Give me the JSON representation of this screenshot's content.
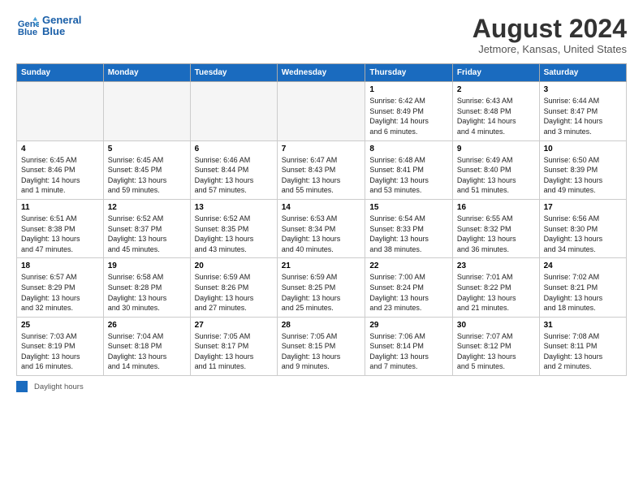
{
  "logo": {
    "line1": "General",
    "line2": "Blue"
  },
  "title": "August 2024",
  "location": "Jetmore, Kansas, United States",
  "days_of_week": [
    "Sunday",
    "Monday",
    "Tuesday",
    "Wednesday",
    "Thursday",
    "Friday",
    "Saturday"
  ],
  "weeks": [
    [
      {
        "day": "",
        "info": ""
      },
      {
        "day": "",
        "info": ""
      },
      {
        "day": "",
        "info": ""
      },
      {
        "day": "",
        "info": ""
      },
      {
        "day": "1",
        "info": "Sunrise: 6:42 AM\nSunset: 8:49 PM\nDaylight: 14 hours\nand 6 minutes."
      },
      {
        "day": "2",
        "info": "Sunrise: 6:43 AM\nSunset: 8:48 PM\nDaylight: 14 hours\nand 4 minutes."
      },
      {
        "day": "3",
        "info": "Sunrise: 6:44 AM\nSunset: 8:47 PM\nDaylight: 14 hours\nand 3 minutes."
      }
    ],
    [
      {
        "day": "4",
        "info": "Sunrise: 6:45 AM\nSunset: 8:46 PM\nDaylight: 14 hours\nand 1 minute."
      },
      {
        "day": "5",
        "info": "Sunrise: 6:45 AM\nSunset: 8:45 PM\nDaylight: 13 hours\nand 59 minutes."
      },
      {
        "day": "6",
        "info": "Sunrise: 6:46 AM\nSunset: 8:44 PM\nDaylight: 13 hours\nand 57 minutes."
      },
      {
        "day": "7",
        "info": "Sunrise: 6:47 AM\nSunset: 8:43 PM\nDaylight: 13 hours\nand 55 minutes."
      },
      {
        "day": "8",
        "info": "Sunrise: 6:48 AM\nSunset: 8:41 PM\nDaylight: 13 hours\nand 53 minutes."
      },
      {
        "day": "9",
        "info": "Sunrise: 6:49 AM\nSunset: 8:40 PM\nDaylight: 13 hours\nand 51 minutes."
      },
      {
        "day": "10",
        "info": "Sunrise: 6:50 AM\nSunset: 8:39 PM\nDaylight: 13 hours\nand 49 minutes."
      }
    ],
    [
      {
        "day": "11",
        "info": "Sunrise: 6:51 AM\nSunset: 8:38 PM\nDaylight: 13 hours\nand 47 minutes."
      },
      {
        "day": "12",
        "info": "Sunrise: 6:52 AM\nSunset: 8:37 PM\nDaylight: 13 hours\nand 45 minutes."
      },
      {
        "day": "13",
        "info": "Sunrise: 6:52 AM\nSunset: 8:35 PM\nDaylight: 13 hours\nand 43 minutes."
      },
      {
        "day": "14",
        "info": "Sunrise: 6:53 AM\nSunset: 8:34 PM\nDaylight: 13 hours\nand 40 minutes."
      },
      {
        "day": "15",
        "info": "Sunrise: 6:54 AM\nSunset: 8:33 PM\nDaylight: 13 hours\nand 38 minutes."
      },
      {
        "day": "16",
        "info": "Sunrise: 6:55 AM\nSunset: 8:32 PM\nDaylight: 13 hours\nand 36 minutes."
      },
      {
        "day": "17",
        "info": "Sunrise: 6:56 AM\nSunset: 8:30 PM\nDaylight: 13 hours\nand 34 minutes."
      }
    ],
    [
      {
        "day": "18",
        "info": "Sunrise: 6:57 AM\nSunset: 8:29 PM\nDaylight: 13 hours\nand 32 minutes."
      },
      {
        "day": "19",
        "info": "Sunrise: 6:58 AM\nSunset: 8:28 PM\nDaylight: 13 hours\nand 30 minutes."
      },
      {
        "day": "20",
        "info": "Sunrise: 6:59 AM\nSunset: 8:26 PM\nDaylight: 13 hours\nand 27 minutes."
      },
      {
        "day": "21",
        "info": "Sunrise: 6:59 AM\nSunset: 8:25 PM\nDaylight: 13 hours\nand 25 minutes."
      },
      {
        "day": "22",
        "info": "Sunrise: 7:00 AM\nSunset: 8:24 PM\nDaylight: 13 hours\nand 23 minutes."
      },
      {
        "day": "23",
        "info": "Sunrise: 7:01 AM\nSunset: 8:22 PM\nDaylight: 13 hours\nand 21 minutes."
      },
      {
        "day": "24",
        "info": "Sunrise: 7:02 AM\nSunset: 8:21 PM\nDaylight: 13 hours\nand 18 minutes."
      }
    ],
    [
      {
        "day": "25",
        "info": "Sunrise: 7:03 AM\nSunset: 8:19 PM\nDaylight: 13 hours\nand 16 minutes."
      },
      {
        "day": "26",
        "info": "Sunrise: 7:04 AM\nSunset: 8:18 PM\nDaylight: 13 hours\nand 14 minutes."
      },
      {
        "day": "27",
        "info": "Sunrise: 7:05 AM\nSunset: 8:17 PM\nDaylight: 13 hours\nand 11 minutes."
      },
      {
        "day": "28",
        "info": "Sunrise: 7:05 AM\nSunset: 8:15 PM\nDaylight: 13 hours\nand 9 minutes."
      },
      {
        "day": "29",
        "info": "Sunrise: 7:06 AM\nSunset: 8:14 PM\nDaylight: 13 hours\nand 7 minutes."
      },
      {
        "day": "30",
        "info": "Sunrise: 7:07 AM\nSunset: 8:12 PM\nDaylight: 13 hours\nand 5 minutes."
      },
      {
        "day": "31",
        "info": "Sunrise: 7:08 AM\nSunset: 8:11 PM\nDaylight: 13 hours\nand 2 minutes."
      }
    ]
  ],
  "legend_label": "Daylight hours"
}
